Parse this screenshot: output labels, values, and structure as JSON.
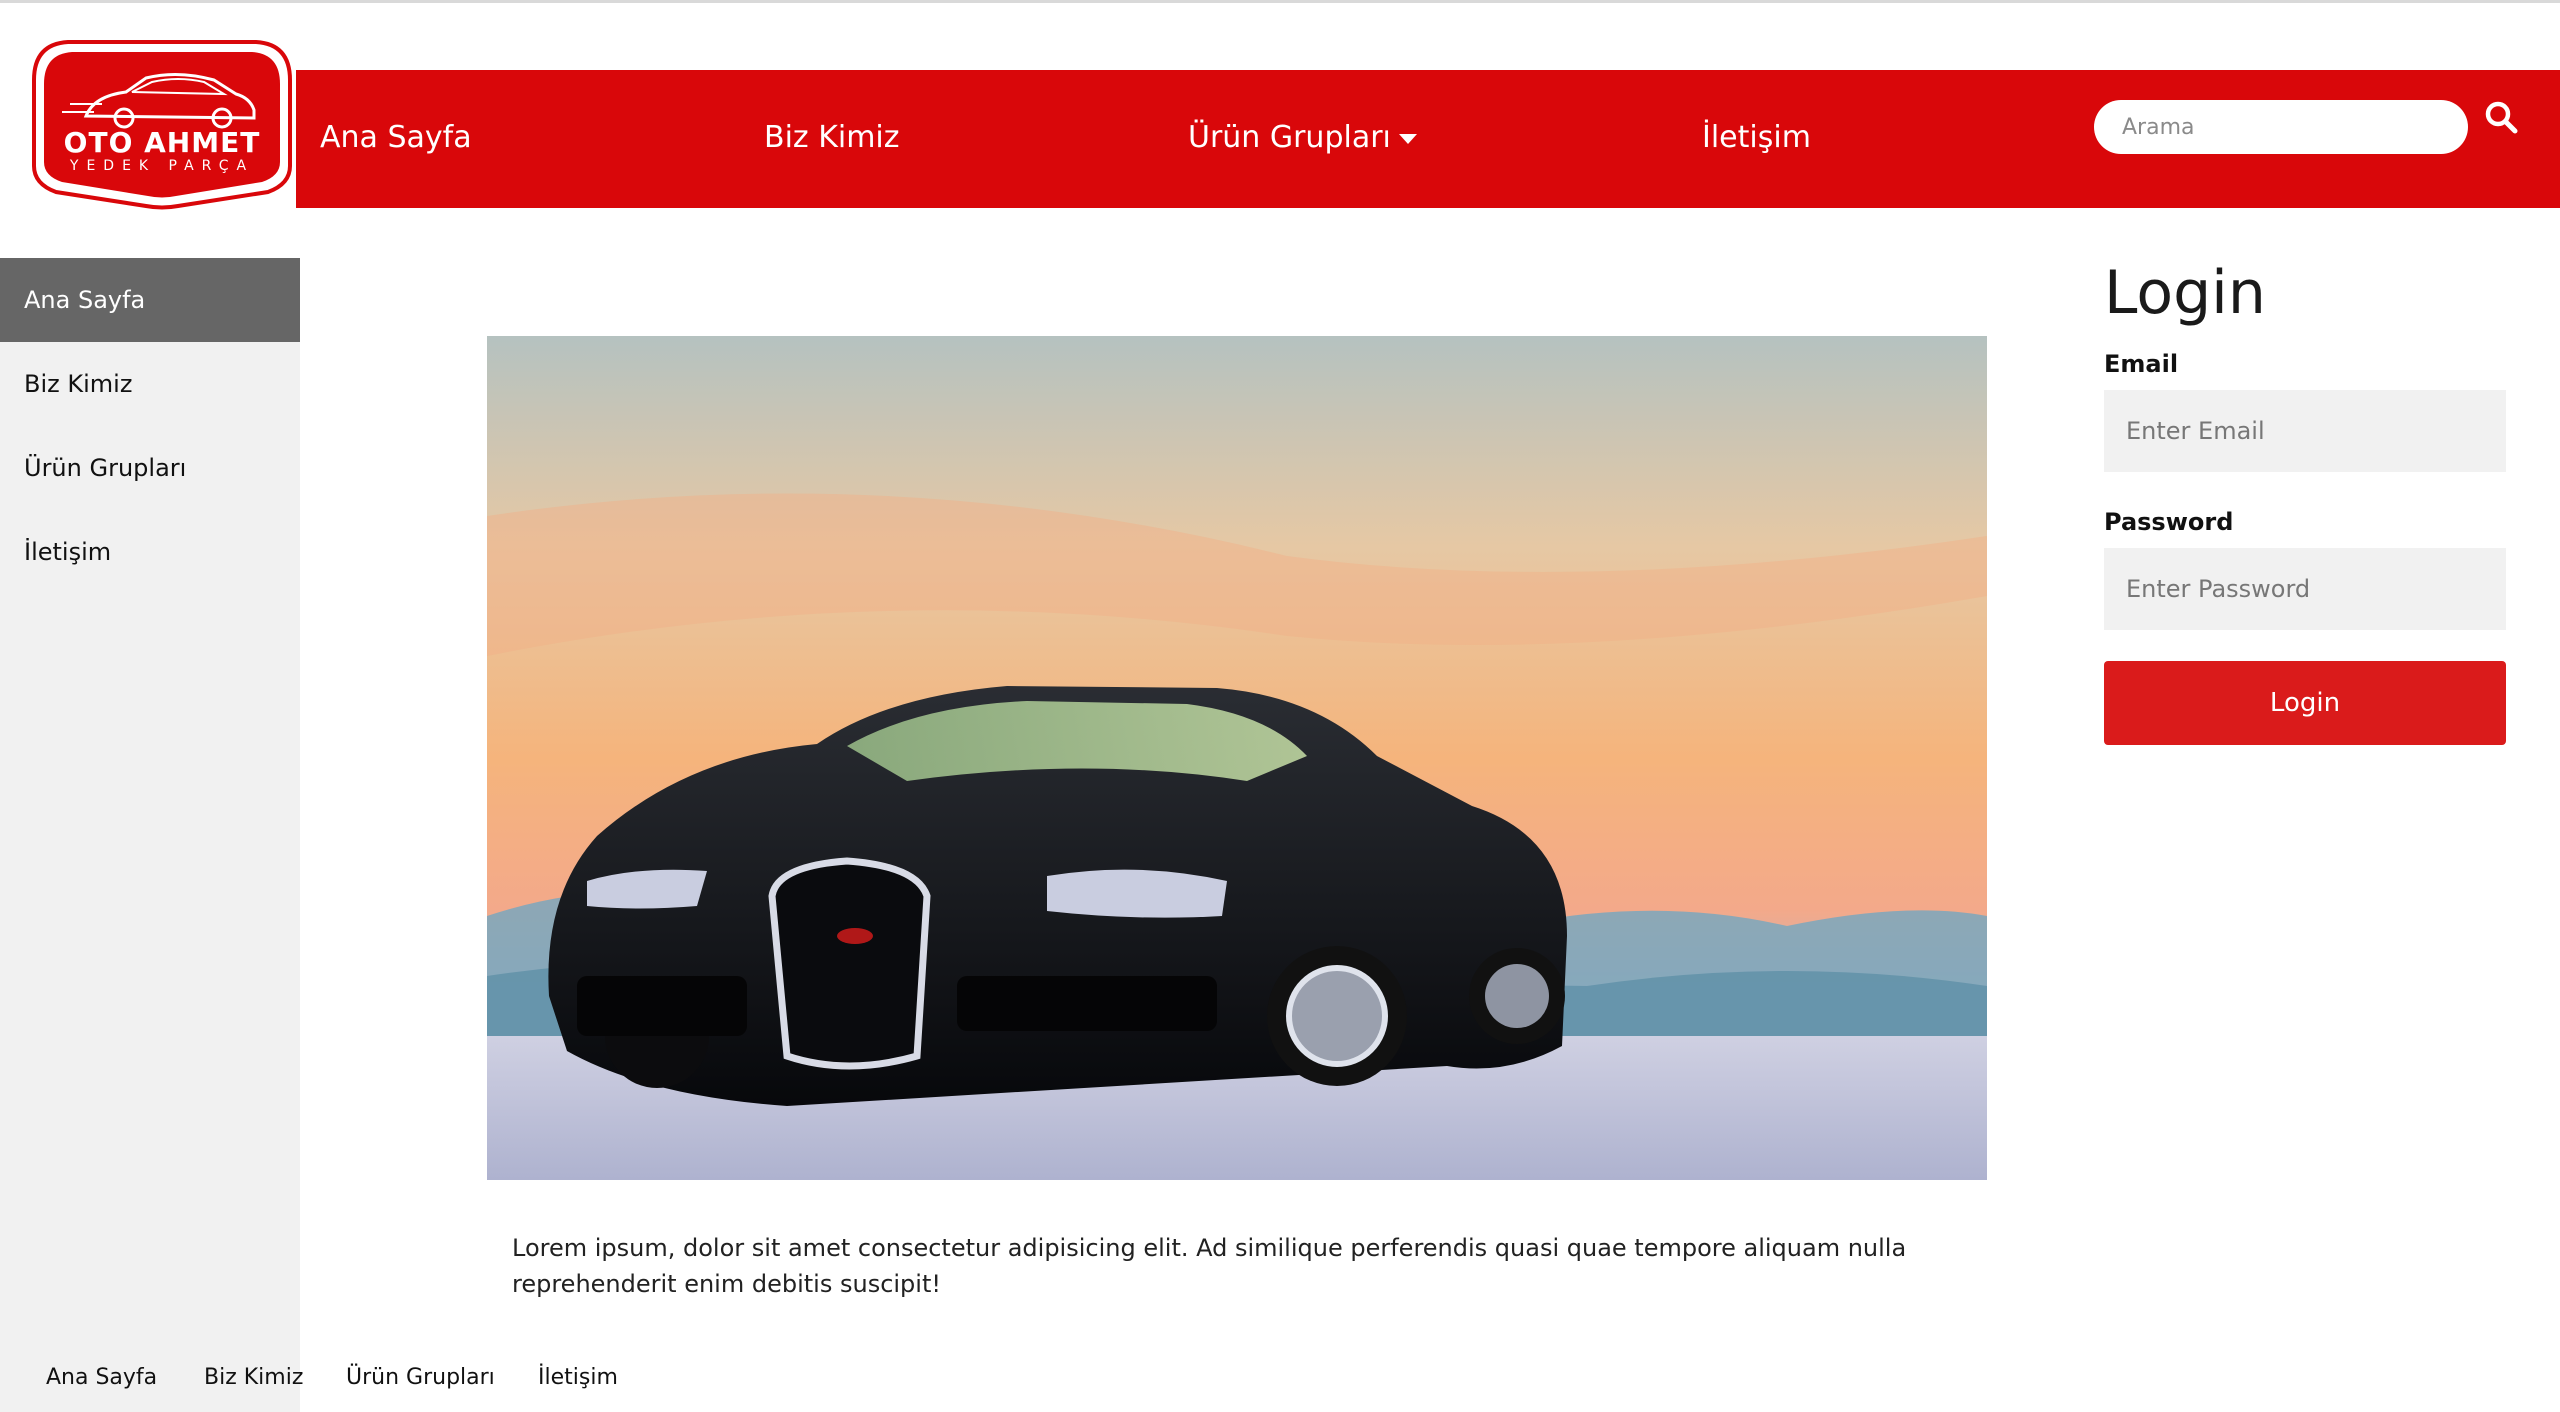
{
  "brand": {
    "name": "OTO AHMET",
    "tagline": "YEDEK PARÇA",
    "color": "#d9070a"
  },
  "header": {
    "nav": [
      {
        "label": "Ana Sayfa"
      },
      {
        "label": "Biz Kimiz"
      },
      {
        "label": "Ürün Grupları",
        "has_dropdown": true
      },
      {
        "label": "İletişim"
      }
    ],
    "search": {
      "placeholder": "Arama",
      "icon": "search-icon"
    }
  },
  "sidebar": {
    "items": [
      {
        "label": "Ana Sayfa",
        "active": true
      },
      {
        "label": "Biz Kimiz"
      },
      {
        "label": "Ürün Grupları"
      },
      {
        "label": "İletişim"
      }
    ]
  },
  "main": {
    "hero_image": "black sports car at sunset",
    "intro_text": "Lorem ipsum, dolor sit amet consectetur adipisicing elit. Ad similique perferendis quasi quae tempore aliquam nulla reprehenderit enim debitis suscipit!"
  },
  "login": {
    "title": "Login",
    "email_label": "Email",
    "email_placeholder": "Enter Email",
    "password_label": "Password",
    "password_placeholder": "Enter Password",
    "button_label": "Login",
    "button_color": "#da1b1b"
  },
  "footer": {
    "nav": [
      {
        "label": "Ana Sayfa"
      },
      {
        "label": "Biz Kimiz"
      },
      {
        "label": "Ürün Grupları"
      },
      {
        "label": "İletişim"
      }
    ]
  }
}
